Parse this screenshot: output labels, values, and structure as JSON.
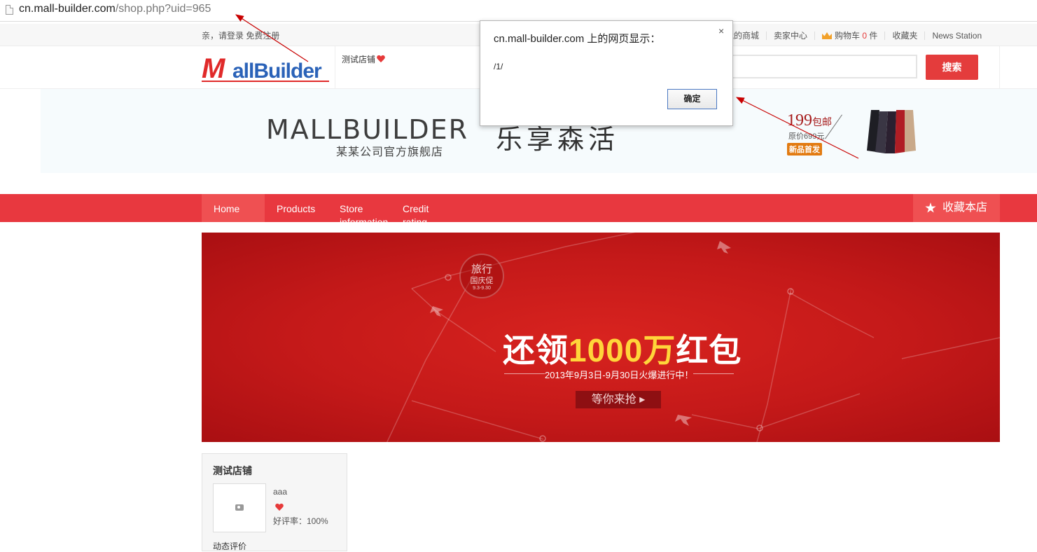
{
  "browser": {
    "url_host": "cn.mall-builder.com",
    "url_path": "/shop.php?uid=965"
  },
  "topbar": {
    "greeting": "亲，请登录 免费注册",
    "links": {
      "my_mall": "我的商城",
      "seller_center": "卖家中心",
      "cart_label": "购物车",
      "cart_count": "0",
      "cart_unit": "件",
      "favorites": "收藏夹",
      "news": "News Station"
    }
  },
  "header": {
    "logo_m": "M",
    "logo_rest": "allBuilder",
    "shop_name": "测试店铺",
    "search_button": "搜索"
  },
  "banner": {
    "brand": "MALLBUILDER",
    "brand_sub": "某某公司官方旗舰店",
    "slogan": "乐享森活",
    "promo_price": "199",
    "promo_price_suffix": "包邮",
    "promo_original": "原价699元",
    "promo_tag": "新品首发"
  },
  "nav": {
    "items": [
      "Home",
      "Products",
      "Store information",
      "Credit rating"
    ],
    "favorite": "收藏本店"
  },
  "promo": {
    "seal_line1": "旅行",
    "seal_line2": "国庆促",
    "seal_line3": "9.3-9.30",
    "title_a": "还领",
    "title_b": "1000万",
    "title_c": "红包",
    "subtitle": "2013年9月3日-9月30日火爆进行中！",
    "button": "等你来抢 ▸"
  },
  "shop_card": {
    "title": "测试店铺",
    "owner": "aaa",
    "rating_label": "好评率：100%",
    "dynamic": "动态评价"
  },
  "dialog": {
    "title": "cn.mall-builder.com 上的网页显示：",
    "message": "/1/",
    "ok": "确定",
    "close": "×"
  },
  "colors": {
    "accent_red": "#e8383f",
    "nav_active": "#ef5052",
    "search_red": "#e43c3c",
    "banner_red": "#c41919",
    "highlight_yellow": "#ffd53a",
    "arrow_red": "#c80000"
  }
}
